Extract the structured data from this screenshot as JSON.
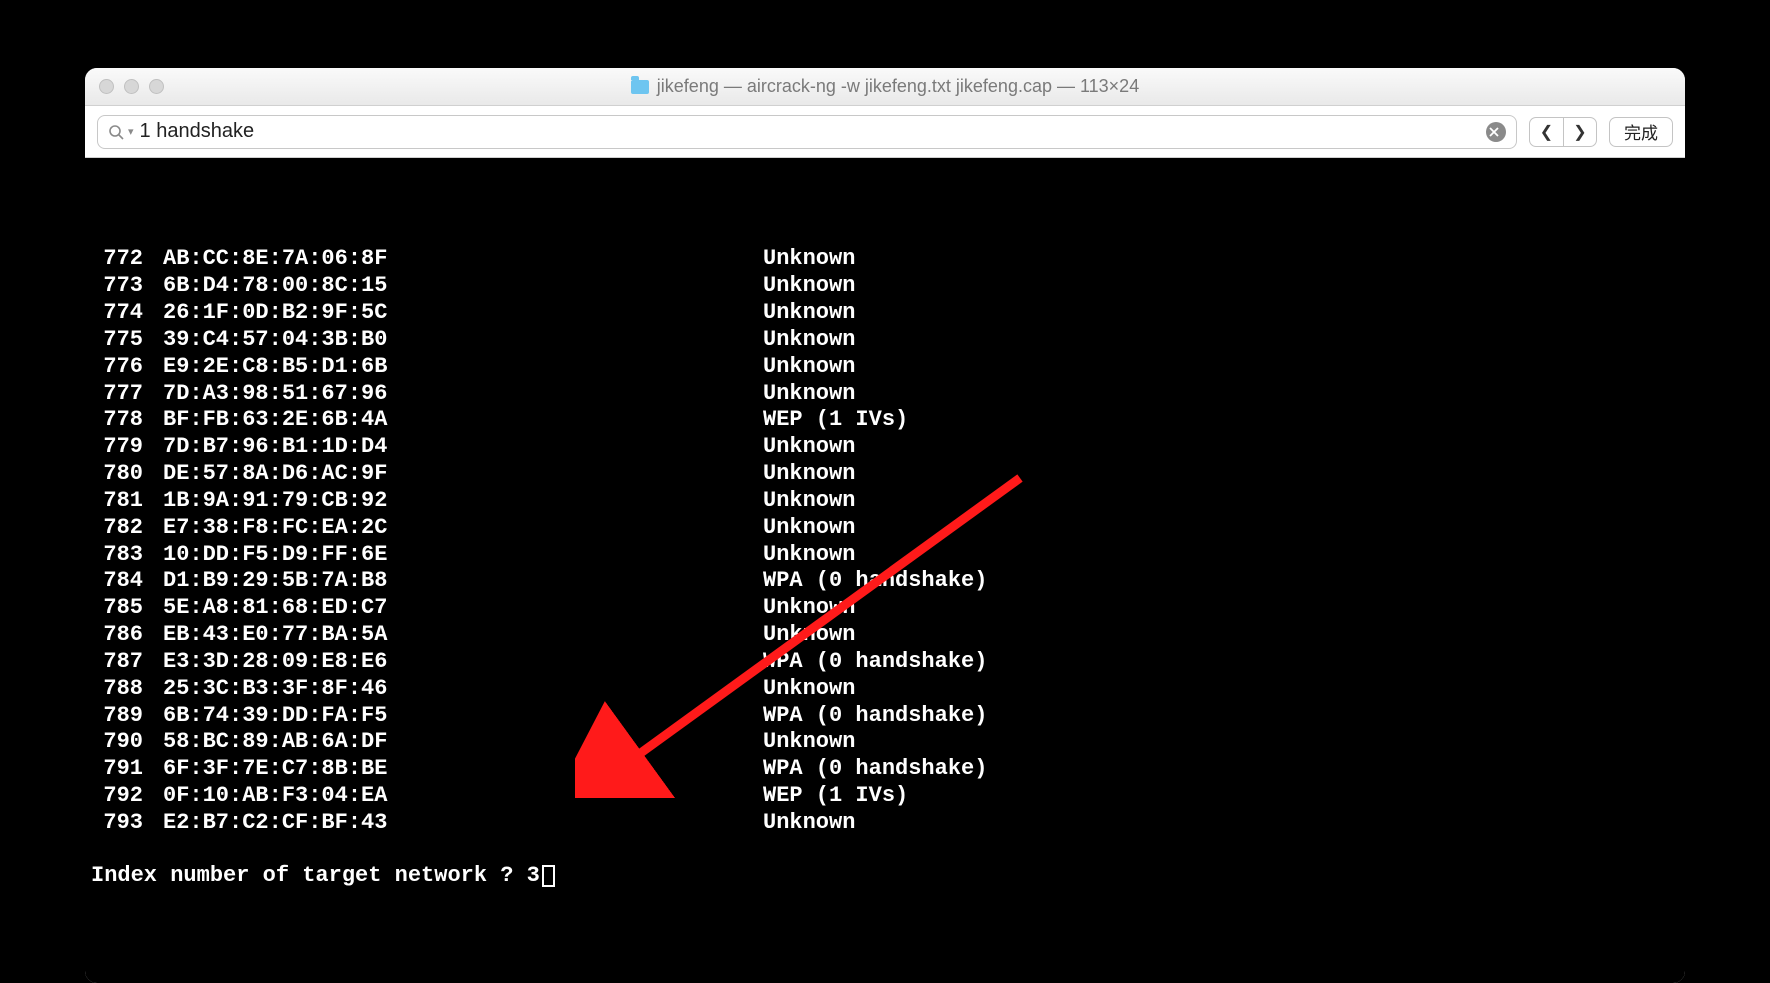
{
  "window": {
    "title": "jikefeng — aircrack-ng -w jikefeng.txt jikefeng.cap — 113×24"
  },
  "search": {
    "value": "1 handshake"
  },
  "buttons": {
    "done": "完成"
  },
  "rows": [
    {
      "idx": "772",
      "mac": "AB:CC:8E:7A:06:8F",
      "enc": "Unknown"
    },
    {
      "idx": "773",
      "mac": "6B:D4:78:00:8C:15",
      "enc": "Unknown"
    },
    {
      "idx": "774",
      "mac": "26:1F:0D:B2:9F:5C",
      "enc": "Unknown"
    },
    {
      "idx": "775",
      "mac": "39:C4:57:04:3B:B0",
      "enc": "Unknown"
    },
    {
      "idx": "776",
      "mac": "E9:2E:C8:B5:D1:6B",
      "enc": "Unknown"
    },
    {
      "idx": "777",
      "mac": "7D:A3:98:51:67:96",
      "enc": "Unknown"
    },
    {
      "idx": "778",
      "mac": "BF:FB:63:2E:6B:4A",
      "enc": "WEP (1 IVs)"
    },
    {
      "idx": "779",
      "mac": "7D:B7:96:B1:1D:D4",
      "enc": "Unknown"
    },
    {
      "idx": "780",
      "mac": "DE:57:8A:D6:AC:9F",
      "enc": "Unknown"
    },
    {
      "idx": "781",
      "mac": "1B:9A:91:79:CB:92",
      "enc": "Unknown"
    },
    {
      "idx": "782",
      "mac": "E7:38:F8:FC:EA:2C",
      "enc": "Unknown"
    },
    {
      "idx": "783",
      "mac": "10:DD:F5:D9:FF:6E",
      "enc": "Unknown"
    },
    {
      "idx": "784",
      "mac": "D1:B9:29:5B:7A:B8",
      "enc": "WPA (0 handshake)"
    },
    {
      "idx": "785",
      "mac": "5E:A8:81:68:ED:C7",
      "enc": "Unknown"
    },
    {
      "idx": "786",
      "mac": "EB:43:E0:77:BA:5A",
      "enc": "Unknown"
    },
    {
      "idx": "787",
      "mac": "E3:3D:28:09:E8:E6",
      "enc": "WPA (0 handshake)"
    },
    {
      "idx": "788",
      "mac": "25:3C:B3:3F:8F:46",
      "enc": "Unknown"
    },
    {
      "idx": "789",
      "mac": "6B:74:39:DD:FA:F5",
      "enc": "WPA (0 handshake)"
    },
    {
      "idx": "790",
      "mac": "58:BC:89:AB:6A:DF",
      "enc": "Unknown"
    },
    {
      "idx": "791",
      "mac": "6F:3F:7E:C7:8B:BE",
      "enc": "WPA (0 handshake)"
    },
    {
      "idx": "792",
      "mac": "0F:10:AB:F3:04:EA",
      "enc": "WEP (1 IVs)"
    },
    {
      "idx": "793",
      "mac": "E2:B7:C2:CF:BF:43",
      "enc": "Unknown"
    }
  ],
  "prompt": {
    "text": "Index number of target network ? ",
    "input": "3"
  }
}
